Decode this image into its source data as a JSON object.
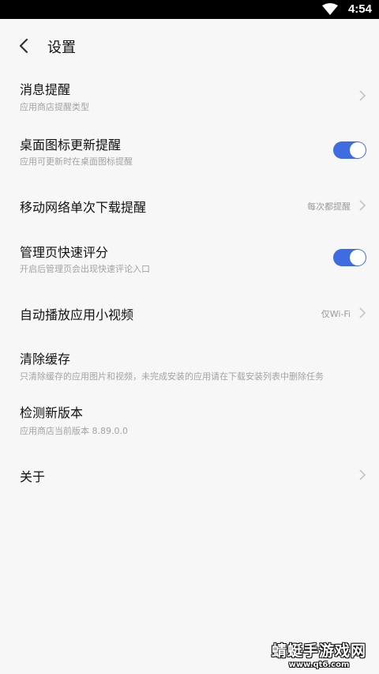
{
  "status_bar": {
    "time": "4:54",
    "wifi_icon": "wifi-icon"
  },
  "header": {
    "title": "设置",
    "back_icon": "chevron-left-icon"
  },
  "settings": [
    {
      "title": "消息提醒",
      "subtitle": "应用商店提醒类型",
      "control": "chevron"
    },
    {
      "title": "桌面图标更新提醒",
      "subtitle": "应用可更新时在桌面图标提醒",
      "control": "toggle",
      "on": true
    },
    {
      "title": "移动网络单次下载提醒",
      "value": "每次都提醒",
      "control": "chevron"
    },
    {
      "title": "管理页快速评分",
      "subtitle": "开启后管理页会出现快速评论入口",
      "control": "toggle",
      "on": true
    },
    {
      "title": "自动播放应用小视频",
      "value": "仅Wi-Fi",
      "control": "chevron"
    },
    {
      "title": "清除缓存",
      "subtitle": "只清除缓存的应用图片和视频，未完成安装的应用请在下载安装列表中删除任务"
    },
    {
      "title": "检测新版本",
      "subtitle": "应用商店当前版本 8.89.0.0"
    },
    {
      "title": "关于",
      "control": "chevron"
    }
  ],
  "watermark": {
    "name": "蜻蜓手游戏网",
    "url": "www.qt6.com"
  },
  "colors": {
    "accent": "#3f6ce0",
    "background": "#f7f7f7",
    "status_bar": "#000000"
  }
}
